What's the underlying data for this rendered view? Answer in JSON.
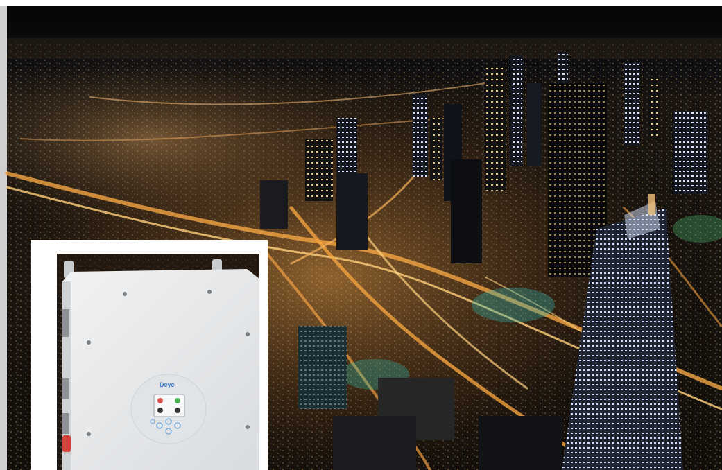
{
  "scene": {
    "description_free": true,
    "colors": {
      "sky": "#0d0d10",
      "city_glow": "#f0a64a",
      "tower_lights": "#dfe8ff",
      "teal_lights": "#3fd1c8",
      "inverter_body": "#e6e8ea",
      "inverter_panel": "#dfe2e5"
    }
  },
  "inverter": {
    "brand_logo": "Deye",
    "buttons": [
      "button-icon",
      "button-icon",
      "button-icon",
      "button-icon",
      "button-icon"
    ]
  }
}
